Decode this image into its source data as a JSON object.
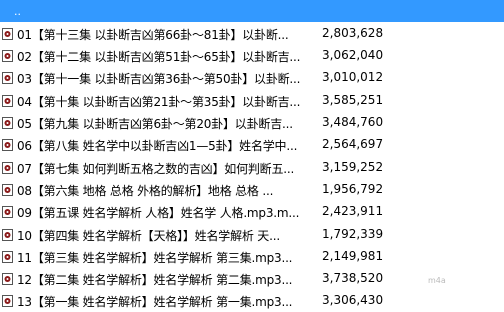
{
  "parent_row": {
    "label": ".."
  },
  "files": [
    {
      "name": "01【第十三集  以卦断吉凶第66卦～81卦】以卦断...",
      "size": "2,803,628"
    },
    {
      "name": "02【第十二集 以卦断吉凶第51卦～65卦】以卦断吉...",
      "size": "3,062,040"
    },
    {
      "name": "03【第十一集 以卦断吉凶第36卦～第50卦】以卦断...",
      "size": "3,010,012"
    },
    {
      "name": "04【第十集 以卦断吉凶第21卦～第35卦】以卦断吉...",
      "size": "3,585,251"
    },
    {
      "name": "05【第九集 以卦断吉凶第6卦～第20卦】以卦断吉...",
      "size": "3,484,760"
    },
    {
      "name": "06【第八集 姓名学中以卦断吉凶1—5卦】姓名学中...",
      "size": "2,564,697"
    },
    {
      "name": "07【第七集 如何判断五格之数的吉凶】如何判断五...",
      "size": "3,159,252"
    },
    {
      "name": "08【第六集 地格  总格  外格的解析】地格  总格  ...",
      "size": "1,956,792"
    },
    {
      "name": "09【第五课 姓名学解析 人格】姓名学 人格.mp3.m...",
      "size": "2,423,911"
    },
    {
      "name": "10【第四集 姓名学解析【天格】】姓名学解析   天...",
      "size": "1,792,339"
    },
    {
      "name": "11【第三集 姓名学解析】姓名学解析    第三集.mp3...",
      "size": "2,149,981"
    },
    {
      "name": "12【第二集 姓名学解析】姓名学解析    第二集.mp3...",
      "size": "3,738,520"
    },
    {
      "name": "13【第一集 姓名学解析】姓名学解析    第一集.mp3...",
      "size": "3,306,430"
    }
  ],
  "watermark": "m4a",
  "colors": {
    "selection": "#3399ff",
    "icon_fill": "#8b1a1a"
  },
  "icon": "audio-file-icon"
}
